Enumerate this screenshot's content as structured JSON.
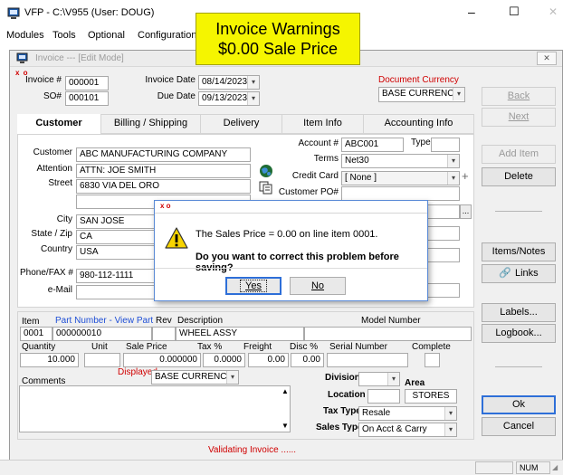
{
  "app": {
    "title": "VFP - C:\\V955 (User: DOUG)",
    "menu": [
      "Modules",
      "Tools",
      "Optional",
      "Configuration"
    ],
    "minimize_glyph": "–",
    "maximize_glyph": "☐",
    "close_glyph": "✕"
  },
  "callout": {
    "line1": "Invoice Warnings",
    "line2": "$0.00 Sale Price",
    "bg": "#f5f500"
  },
  "window": {
    "title": "Invoice --- [Edit Mode]",
    "close_glyph": "✕",
    "indicator": "x o"
  },
  "header": {
    "invoice_label": "Invoice #",
    "invoice_value": "000001",
    "so_label": "SO#",
    "so_value": "000101",
    "invoice_date_label": "Invoice Date",
    "invoice_date_value": "08/14/2023",
    "due_date_label": "Due Date",
    "due_date_value": "09/13/2023",
    "doc_currency_label": "Document Currency",
    "doc_currency_value": "BASE CURRENCY"
  },
  "tabs": [
    "Customer",
    "Billing / Shipping",
    "Delivery",
    "Item Info",
    "Accounting Info"
  ],
  "customer": {
    "customer_label": "Customer",
    "customer_value": "ABC MANUFACTURING COMPANY",
    "attention_label": "Attention",
    "attention_value": "ATTN: JOE SMITH",
    "street_label": "Street",
    "street_value": "6830 VIA DEL ORO",
    "city_label": "City",
    "city_value": "SAN JOSE",
    "state_label": "State / Zip",
    "state_value": "CA",
    "country_label": "Country",
    "country_value": "USA",
    "phone_label": "Phone/FAX #",
    "phone_value": "980-112-1111",
    "email_label": "e-Mail",
    "account_label": "Account #",
    "account_value": "ABC001",
    "type_label": "Type",
    "terms_label": "Terms",
    "terms_value": "Net30",
    "credit_card_label": "Credit Card",
    "credit_card_value": "[ None ]",
    "customer_po_label": "Customer PO#",
    "plus_glyph": "+",
    "ellipsis_glyph": "..."
  },
  "dialog": {
    "indicator": "x o",
    "message": "The Sales Price = 0.00 on line item 0001.",
    "question": "Do you want to correct this problem before saving?",
    "yes": "Yes",
    "no": "No"
  },
  "buttons": {
    "back": "Back",
    "next": "Next",
    "add_item": "Add Item",
    "delete": "Delete",
    "items_notes": "Items/Notes",
    "links": "Links",
    "labels": "Labels...",
    "logbook": "Logbook...",
    "ok": "Ok",
    "cancel": "Cancel"
  },
  "item": {
    "item_label": "Item",
    "part_number_label": "Part Number - View Part",
    "rev_label": "Rev",
    "description_label": "Description",
    "model_label": "Model Number",
    "item_value": "0001",
    "part_value": "000000010",
    "description_value": "WHEEL ASSY",
    "quantity_label": "Quantity",
    "unit_label": "Unit",
    "sale_price_label": "Sale Price",
    "tax_label": "Tax %",
    "freight_label": "Freight",
    "disc_label": "Disc %",
    "serial_label": "Serial Number",
    "complete_label": "Complete",
    "quantity_value": "10.000",
    "sale_price_value": "0.000000",
    "tax_value": "0.0000",
    "freight_value": "0.00",
    "disc_value": "0.00",
    "displayed_label": "Displayed",
    "displayed_currency": "BASE CURRENCY",
    "comments_label": "Comments",
    "division_label": "Division",
    "area_label": "Area",
    "location_label": "Location",
    "location_value": "STORES",
    "tax_type_label": "Tax Type",
    "tax_type_value": "Resale",
    "sales_type_label": "Sales Type",
    "sales_type_value": "On Acct & Carry"
  },
  "status": {
    "message": "Validating Invoice ......",
    "num": "NUM",
    "message_color": "#d00000"
  }
}
